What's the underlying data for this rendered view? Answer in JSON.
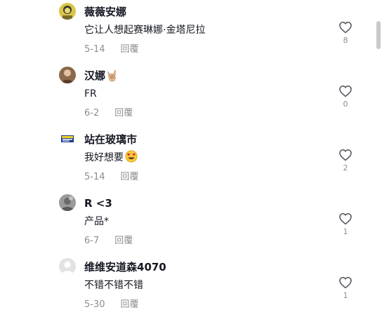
{
  "comments": [
    {
      "username": "薇薇安娜",
      "text": "它让人想起赛琳娜·金塔尼拉",
      "date": "5-14",
      "reply": "回覆",
      "likes": "8"
    },
    {
      "username": "汉娜🤘🏼",
      "text": "FR",
      "date": "6-2",
      "reply": "回覆",
      "likes": "0"
    },
    {
      "username": "站在玻璃市",
      "text": "我好想要",
      "emoji": "heart-eyes-emoji",
      "date": "5-14",
      "reply": "回覆",
      "likes": "2"
    },
    {
      "username": "R <3",
      "text": "产品*",
      "date": "6-7",
      "reply": "回覆",
      "likes": "1"
    },
    {
      "username": "维维安道森4070",
      "text": "不错不错不错",
      "date": "5-30",
      "reply": "回覆",
      "likes": "1"
    }
  ],
  "icons": {
    "like": "heart-outline-icon",
    "avatar_default": "default-avatar-icon"
  },
  "colors": {
    "text_primary": "#161823",
    "text_secondary": "rgba(22,24,35,0.5)",
    "scrollbar_thumb": "#c9c9cc"
  }
}
